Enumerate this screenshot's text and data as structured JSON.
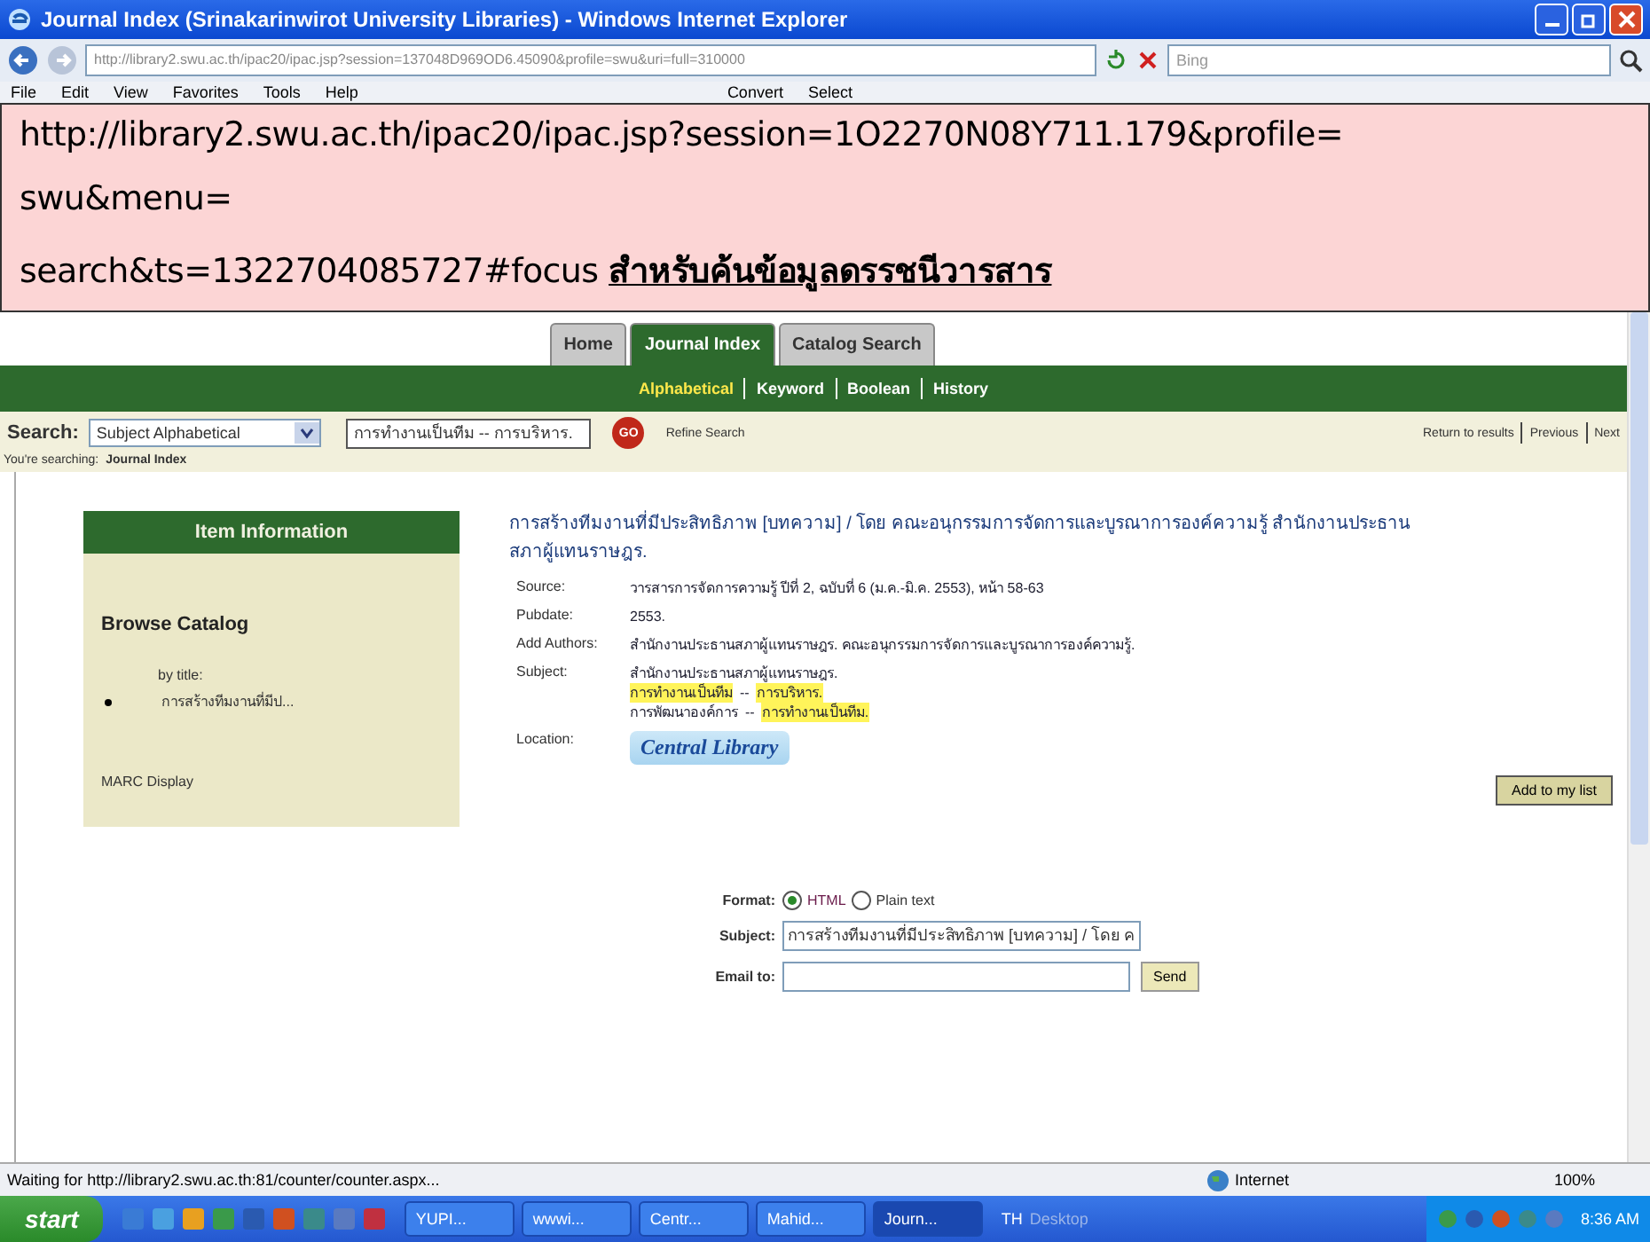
{
  "window": {
    "title": "Journal Index (Srinakarinwirot University Libraries) - Windows Internet Explorer"
  },
  "address_bar": {
    "url": "http://library2.swu.ac.th/ipac20/ipac.jsp?session=137048D969OD6.45090&profile=swu&uri=full=310000",
    "search_placeholder": "Bing"
  },
  "menu": [
    "File",
    "Edit",
    "View",
    "Favorites",
    "Tools",
    "Help"
  ],
  "toolbar": [
    "Convert",
    "Select"
  ],
  "callout": {
    "lines": [
      "http://library2.swu.ac.th/ipac20/ipac.jsp?session=1O2270N08Y711.179&profile=",
      "swu&menu=",
      "search&ts=1322704085727#focus"
    ],
    "link": "สำหรับค้นข้อมูลดรรชนีวารสาร"
  },
  "tabs": [
    {
      "label": "Home",
      "selected": false
    },
    {
      "label": "Journal Index",
      "selected": true
    },
    {
      "label": "Catalog Search",
      "selected": false
    }
  ],
  "subnav": [
    {
      "label": "Alphabetical",
      "selected": true
    },
    {
      "label": "Keyword",
      "selected": false
    },
    {
      "label": "Boolean",
      "selected": false
    },
    {
      "label": "History",
      "selected": false
    }
  ],
  "search": {
    "label": "Search:",
    "type": "Subject Alphabetical",
    "value": "การทำงานเป็นทีม -- การบริหาร.",
    "go": "GO",
    "refine": "Refine Search",
    "nav": [
      "Return to results",
      "Previous",
      "Next"
    ]
  },
  "searching": {
    "label": "You're searching:",
    "value": "Journal Index"
  },
  "sidebar": {
    "header": "Item Information",
    "heading": "Browse Catalog",
    "by": "by title:",
    "items": [
      "การสร้างทีมงานที่มีป..."
    ],
    "marc": "MARC Display"
  },
  "record": {
    "title": "การสร้างทีมงานที่มีประสิทธิภาพ [บทความ] / โดย คณะอนุกรรมการจัดการและบูรณาการองค์ความรู้ สำนักงานประธานสภาผู้แทนราษฎร.",
    "fields": [
      {
        "label": "Source:",
        "lines": [
          [
            {
              "text": "วารสารการจัดการความรู้ ปีที่ 2, ฉบับที่ 6 (ม.ค.-มิ.ค. 2553), หน้า 58-63",
              "highlighted": false
            }
          ]
        ]
      },
      {
        "label": "Pubdate:",
        "lines": [
          [
            {
              "text": "2553.",
              "highlighted": false
            }
          ]
        ]
      },
      {
        "label": "Add Authors:",
        "lines": [
          [
            {
              "text": "สำนักงานประธานสภาผู้แทนราษฎร. คณะอนุกรรมการจัดการและบูรณาการองค์ความรู้.",
              "highlighted": false
            }
          ]
        ]
      },
      {
        "label": "Subject:",
        "lines": [
          [
            {
              "text": "สำนักงานประธานสภาผู้แทนราษฎร.",
              "highlighted": false
            }
          ],
          [
            {
              "text": "การทำงานเป็นทีม",
              "highlighted": true
            },
            {
              "text": "--",
              "highlighted": false
            },
            {
              "text": "การบริหาร.",
              "highlighted": true
            }
          ],
          [
            {
              "text": "การพัฒนาองค์การ",
              "highlighted": false
            },
            {
              "text": "--",
              "highlighted": false
            },
            {
              "text": "การทำงานเป็นทีม.",
              "highlighted": true
            }
          ]
        ]
      }
    ],
    "location_label": "Location:",
    "location": "Central Library",
    "add_button": "Add to my list"
  },
  "email": {
    "format_label": "Format:",
    "formats": [
      {
        "label": "HTML",
        "selected": true
      },
      {
        "label": "Plain text",
        "selected": false
      }
    ],
    "subject_label": "Subject:",
    "subject_value": "การสร้างทีมงานที่มีประสิทธิภาพ [บทความ] / โดย ค",
    "email_label": "Email to:",
    "send": "Send"
  },
  "status_bar": {
    "text": "Waiting for http://library2.swu.ac.th:81/counter/counter.aspx...",
    "zone": "Internet",
    "zoom": "100%"
  },
  "taskbar": {
    "start": "start",
    "tasks": [
      {
        "label": "YUPI...",
        "selected": false
      },
      {
        "label": "wwwi...",
        "selected": false
      },
      {
        "label": "Centr...",
        "selected": false
      },
      {
        "label": "Mahid...",
        "selected": false
      },
      {
        "label": "Journ...",
        "selected": true
      }
    ],
    "language": "TH",
    "desktop": "Desktop",
    "clock": "8:36 AM"
  }
}
